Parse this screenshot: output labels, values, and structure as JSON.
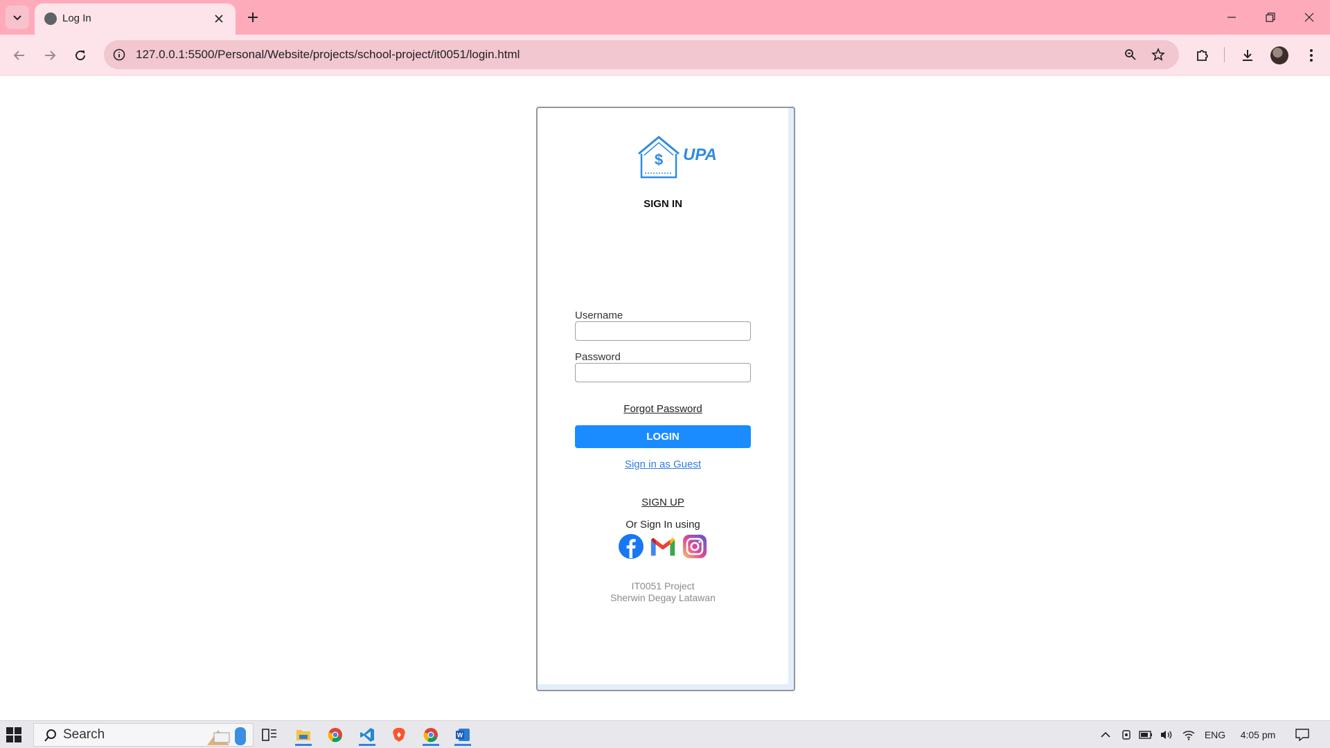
{
  "browser": {
    "tab_title": "Log In",
    "url": "127.0.0.1:5500/Personal/Website/projects/school-project/it0051/login.html"
  },
  "page": {
    "logo_text": "UPA",
    "heading": "SIGN IN",
    "username_label": "Username",
    "username_value": "",
    "password_label": "Password",
    "password_value": "",
    "forgot_password": "Forgot Password",
    "login_button": "LOGIN",
    "guest_link": "Sign in as Guest",
    "signup_link": "SIGN UP",
    "or_sign_in": "Or Sign In using",
    "social_icons": [
      "facebook-icon",
      "gmail-icon",
      "instagram-icon"
    ],
    "footer_line1": "IT0051 Project",
    "footer_line2": "Sherwin Degay Latawan"
  },
  "taskbar": {
    "search_label": "Search",
    "language": "ENG",
    "time": "4:05 pm"
  },
  "colors": {
    "tabstrip": "#fdabbb",
    "toolbar": "#fde4ea",
    "accent_button": "#1a8cff",
    "logo_blue": "#2f8be0"
  }
}
